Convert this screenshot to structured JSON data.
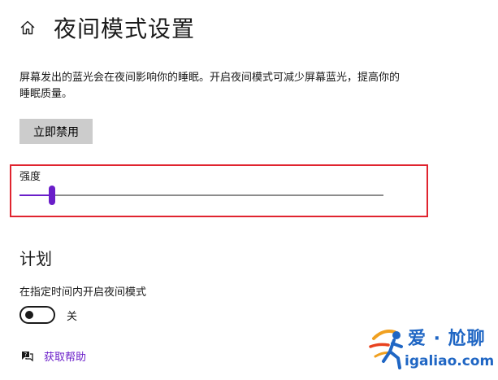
{
  "header": {
    "title": "夜间模式设置",
    "home_icon": "home-icon"
  },
  "description": "屏幕发出的蓝光会在夜间影响你的睡眠。开启夜间模式可减少屏幕蓝光，提高你的睡眠质量。",
  "disable_button": {
    "label": "立即禁用"
  },
  "strength": {
    "label": "强度",
    "value_fraction": 0.09,
    "accent": "#6a1ec9"
  },
  "schedule": {
    "title": "计划",
    "toggle_label": "在指定时间内开启夜间模式",
    "toggle_state": "关",
    "toggle_on": false
  },
  "help": {
    "icon": "help-chat-icon",
    "label": "获取帮助",
    "link_color": "#6a1ec9"
  },
  "highlight_color": "#e0242f",
  "watermark": {
    "brand": "爱 · 尬聊",
    "url": "igaliao.com"
  }
}
